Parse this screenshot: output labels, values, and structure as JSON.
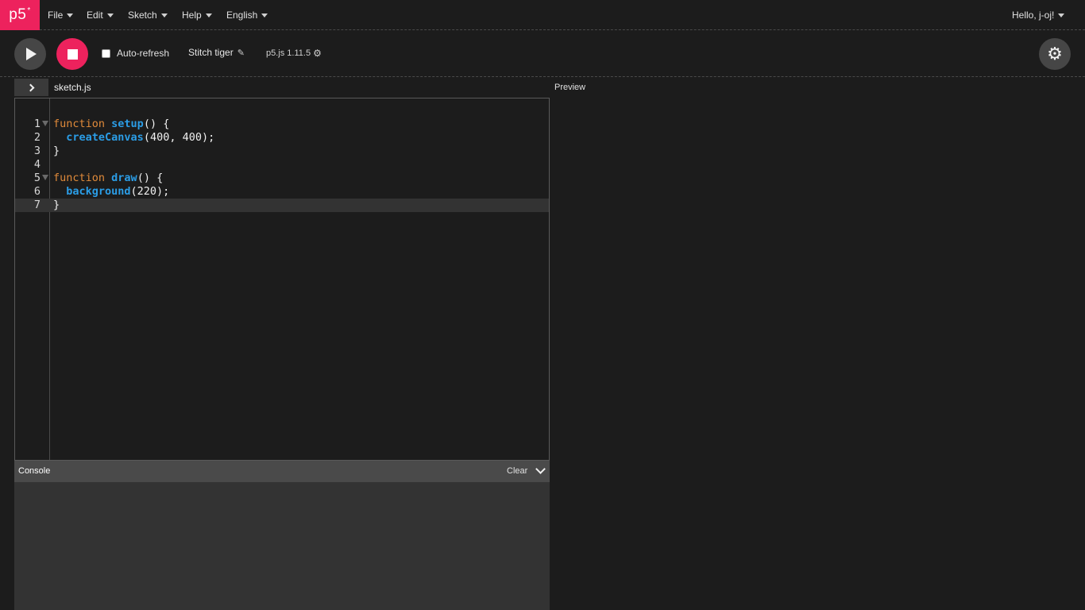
{
  "nav": {
    "logo_text": "p5",
    "logo_star": "*",
    "menus": [
      "File",
      "Edit",
      "Sketch",
      "Help",
      "English"
    ],
    "user_greeting": "Hello, j-oj!"
  },
  "toolbar": {
    "auto_refresh_label": "Auto-refresh",
    "auto_refresh_checked": false,
    "sketch_name": "Stitch tiger",
    "version": "p5.js 1.11.5"
  },
  "editor": {
    "file_tab": "sketch.js",
    "lines": [
      {
        "n": "1",
        "fold": true
      },
      {
        "n": "2",
        "fold": false
      },
      {
        "n": "3",
        "fold": false
      },
      {
        "n": "4",
        "fold": false
      },
      {
        "n": "5",
        "fold": true
      },
      {
        "n": "6",
        "fold": false
      },
      {
        "n": "7",
        "fold": false,
        "active": true
      }
    ],
    "code_tokens": {
      "kw_function": "function",
      "setup": "setup",
      "setup_tail": "() {",
      "createCanvas": "createCanvas",
      "createCanvas_args": "(400, 400);",
      "close": "}",
      "draw": "draw",
      "draw_tail": "() {",
      "background": "background",
      "background_args": "(220);"
    }
  },
  "preview": {
    "label": "Preview"
  },
  "console": {
    "title": "Console",
    "clear_label": "Clear"
  },
  "colors": {
    "accent": "#ed225d",
    "keyword": "#e08a3a",
    "function": "#2b9de6"
  }
}
